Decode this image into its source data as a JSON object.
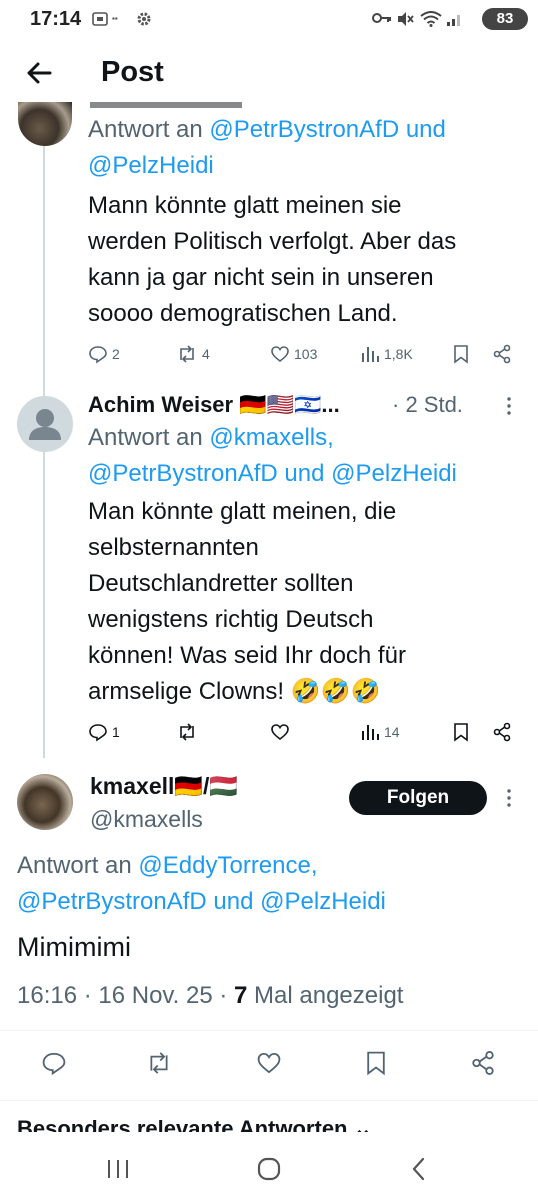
{
  "status_bar": {
    "time": "17:14",
    "battery": "83"
  },
  "header": {
    "title": "Post"
  },
  "tweet1": {
    "reply_prefix": "Antwort an ",
    "reply_line1_handle": "@PetrBystronAfD",
    "reply_and": " und",
    "reply_line2_handle": "@PelzHeidi",
    "text_lines": [
      "Mann könnte glatt meinen sie",
      "werden Politisch verfolgt. Aber das",
      "kann ja gar nicht sein in unseren",
      "soooo demogratischen Land."
    ],
    "replies": "2",
    "reposts": "4",
    "likes": "103",
    "views": "1,8K"
  },
  "tweet2": {
    "name": "Achim Weiser 🇩🇪🇺🇸🇮🇱...",
    "time": "· 2 Std.",
    "reply_prefix": "Antwort an ",
    "reply_handle1": "@kmaxells,",
    "reply_handle2": "@PetrBystronAfD",
    "reply_and": " und ",
    "reply_handle3": "@PelzHeidi",
    "text_lines": [
      "Man könnte glatt meinen, die",
      "selbsternannten",
      "Deutschlandretter sollten",
      "wenigstens richtig Deutsch",
      "können! Was seid Ihr doch für",
      "armselige Clowns! 🤣🤣🤣"
    ],
    "replies": "1",
    "reposts": "",
    "likes": "",
    "views": "14"
  },
  "main_tweet": {
    "name": "kmaxell🇩🇪/🇭🇺",
    "handle": "@kmaxells",
    "follow_label": "Folgen",
    "reply_prefix": "Antwort an ",
    "reply_handle1": "@EddyTorrence,",
    "reply_handle2": "@PetrBystronAfD",
    "reply_and": " und ",
    "reply_handle3": "@PelzHeidi",
    "text": "Mimimimi",
    "meta_time": "16:16 · 16 Nov. 25 · ",
    "meta_views_count": "7",
    "meta_views_label": " Mal angezeigt"
  },
  "relevant_header": "Besonders relevante Antworten",
  "icons": [
    "back-arrow-icon",
    "reply-icon",
    "repost-icon",
    "like-icon",
    "views-icon",
    "bookmark-icon",
    "share-icon",
    "more-icon",
    "nav-recents-icon",
    "nav-home-icon",
    "nav-back-icon"
  ],
  "colors": {
    "link": "#1d9bf0",
    "muted": "#536471",
    "text": "#0f1419",
    "follow_bg": "#0f1419"
  }
}
